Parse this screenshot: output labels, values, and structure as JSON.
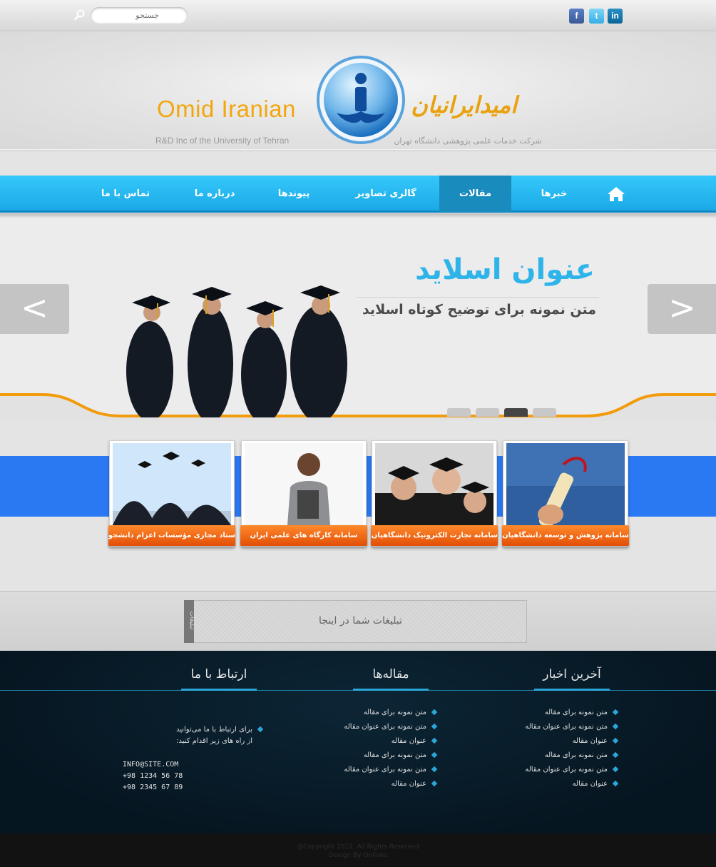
{
  "topbar": {
    "search_placeholder": "جستجو",
    "social": [
      {
        "name": "facebook",
        "glyph": "f"
      },
      {
        "name": "twitter",
        "glyph": "t"
      },
      {
        "name": "linkedin",
        "glyph": "in"
      }
    ]
  },
  "header": {
    "brand_en": "Omid Iranian",
    "brand_en_sub": "R&D Inc of the University of Tehran",
    "brand_fa": "امیدایرانیان",
    "brand_fa_sub": "شرکت خدمات علمی پژوهشی دانشگاه تهران",
    "accent_color": "#f2a60f"
  },
  "nav": {
    "home_icon": "home-icon",
    "items": [
      "خبرها",
      "مقالات",
      "گالری تصاویر",
      "پیوندها",
      "درباره ما",
      "تماس با ما"
    ],
    "active": "مقالات"
  },
  "slider": {
    "title": "عنوان اسلاید",
    "description": "متن نمونه برای توضیح کوتاه اسلاید",
    "prev_label": "<",
    "next_label": ">",
    "dots": 4,
    "active_dot": 3
  },
  "cards": [
    {
      "caption": "سامانه پژوهش و توسعه دانشگاهیان",
      "image": "diploma"
    },
    {
      "caption": "سامانه تجارت الکترونیک دانشگاهیان ایران",
      "image": "graduates-smiling"
    },
    {
      "caption": "سامانه کارگاه های علمی ایران",
      "image": "student"
    },
    {
      "caption": "ستاد مجازی مؤسسات اعزام دانشجو",
      "image": "caps-thrown"
    }
  ],
  "ad": {
    "tab_label": "تبلیغات",
    "text": "تبلیغات شما در اینجا"
  },
  "footer": {
    "columns": [
      {
        "title": "آخرین اخبار",
        "items": [
          "متن نمونه برای مقاله",
          "متن نمونه برای عنوان مقاله",
          "عنوان مقاله",
          "متن نمونه برای مقاله",
          "متن نمونه برای عنوان مقاله",
          "عنوان مقاله"
        ]
      },
      {
        "title": "مقاله‌ها",
        "items": [
          "متن نمونه برای مقاله",
          "متن نمونه برای عنوان مقاله",
          "عنوان مقاله",
          "متن نمونه برای مقاله",
          "متن نمونه برای عنوان مقاله",
          "عنوان مقاله"
        ]
      },
      {
        "title": "ارتباط با ما",
        "intro_line1": "برای ارتباط با ما می‌توانید",
        "intro_line2": "از راه های زیر اقدام کنید:",
        "email": "INFO@SITE.COM",
        "phone1": "+98 1234 56 78",
        "phone2": "+98 2345 67 89"
      }
    ],
    "copyright": "@Copyright 2012, All Rights Reserved",
    "credit": "Design By Onlines"
  }
}
